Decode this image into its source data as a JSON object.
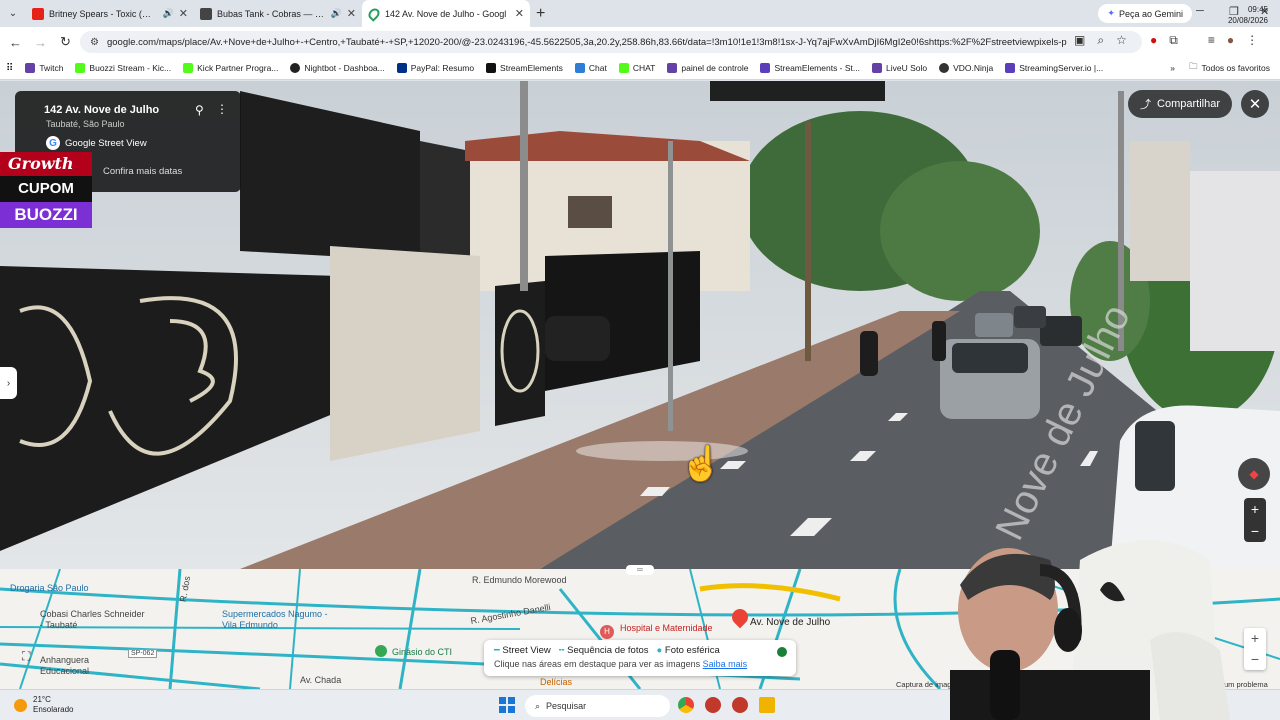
{
  "browser": {
    "tabs": [
      {
        "title": "Britney Spears - Toxic (Offic",
        "active": false
      },
      {
        "title": "Bubas Tank - Cobras — Bai",
        "active": false
      },
      {
        "title": "142 Av. Nove de Julho - Googl",
        "active": true
      }
    ],
    "gemini_label": "Peça ao Gemini",
    "url": "google.com/maps/place/Av.+Nove+de+Julho+-+Centro,+Taubaté+-+SP,+12020-200/@-23.0243196,-45.5622505,3a,20.2y,258.86h,83.66t/data=!3m10!1e1!3m8!1sx-J-Yq7ajFwXvAmDjI6MgI2e0!6shttps:%2F%2Fstreetviewpixels-pa.g...",
    "bookmarks": [
      "Twitch",
      "Buozzi Stream - Kic...",
      "Kick Partner Progra...",
      "Nightbot - Dashboa...",
      "PayPal: Resumo",
      "StreamElements",
      "Chat",
      "CHAT",
      "painel de controle",
      "StreamElements - St...",
      "LiveU Solo",
      "VDO.Ninja",
      "StreamingServer.io |..."
    ],
    "all_bookmarks": "Todos os favoritos"
  },
  "streetview": {
    "place_title": "142 Av. Nove de Julho",
    "place_subtitle": "Taubaté, São Paulo",
    "source": "Google Street View",
    "more_dates": "Confira mais datas",
    "share_label": "Compartilhar",
    "street_painted": "Nove de Julho"
  },
  "promo": {
    "line1": "Growth",
    "line2": "CUPOM",
    "line3": "BUOZZI"
  },
  "map": {
    "labels": {
      "drogaria": "Drogaria São Paulo",
      "cobasi": "Cobasi Charles Schneider - Taubaté",
      "nagumo": "Supermercados Nagumo - Vila Edmundo",
      "hospital": "Hospital e Maternidade",
      "avnove": "Av. Nove de Julho",
      "ginasio": "Ginásio do CTI",
      "anhanguera": "Anhanguera Educacional",
      "edmundo": "R. Edmundo Morewood",
      "agostinho": "R. Agostinho Danelli",
      "sp": "SP-062",
      "chada": "Av. Chada",
      "delicias": "Delícias",
      "rdos": "R. dos"
    },
    "svpanel": {
      "street_view": "Street View",
      "photo_seq": "Sequência de fotos",
      "spherical": "Foto esférica",
      "hint": "Clique nas áreas em destaque para ver as imagens",
      "learn_more": "Saiba mais"
    },
    "attribution": "Captura de image",
    "report": "um problema"
  },
  "taskbar": {
    "temperature": "21°C",
    "condition": "Ensolarado",
    "search_placeholder": "Pesquisar",
    "time": "09:45",
    "date": "20/08/2026"
  }
}
